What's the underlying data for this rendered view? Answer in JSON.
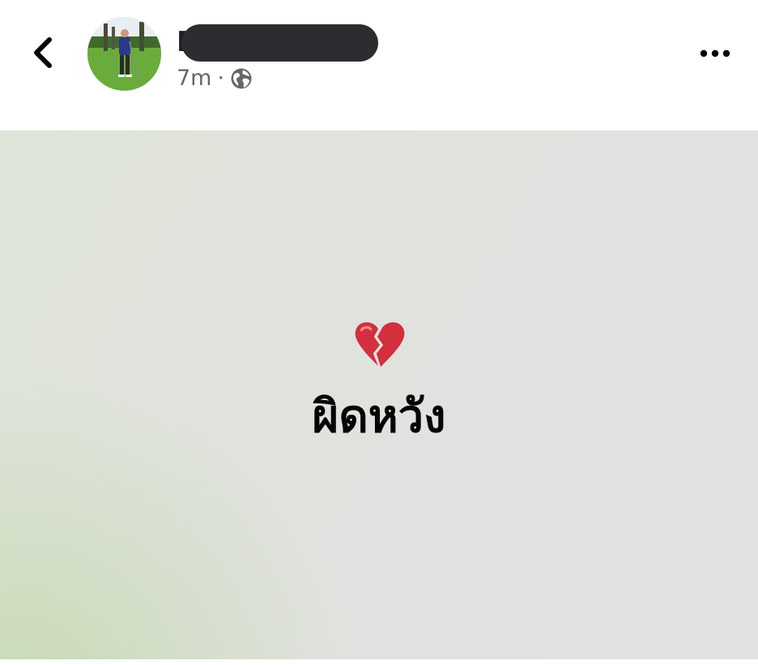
{
  "header": {
    "author_initial": "F",
    "timestamp": "7m",
    "separator": "·",
    "privacy_icon": "globe-icon",
    "back_icon": "chevron-left-icon",
    "more_icon": "ellipsis-icon"
  },
  "post": {
    "emoji_icon": "broken-heart-icon",
    "text": "ผิดหวัง",
    "colors": {
      "background": "#e0e2de",
      "accent_green": "#bed7a5",
      "text": "#050505"
    }
  }
}
